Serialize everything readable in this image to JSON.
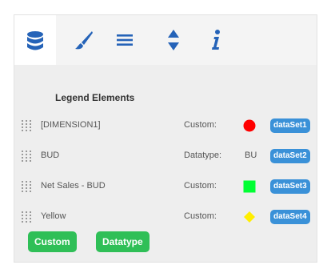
{
  "tabs": [
    {
      "icon": "database-icon",
      "active": true
    },
    {
      "icon": "brush-icon",
      "active": false
    },
    {
      "icon": "list-icon",
      "active": false
    },
    {
      "icon": "sort-icon",
      "active": false
    },
    {
      "icon": "info-icon",
      "active": false
    }
  ],
  "legend": {
    "title": "Legend Elements",
    "items": [
      {
        "label": "[DIMENSION1]",
        "type_label": "Custom:",
        "swatch": "circle",
        "color": "#ff0000",
        "dataset": "dataSet1"
      },
      {
        "label": "BUD",
        "type_label": "Datatype:",
        "swatch": "text",
        "swatch_text": "BU",
        "dataset": "dataSet2"
      },
      {
        "label": "Net Sales - BUD",
        "type_label": "Custom:",
        "swatch": "square",
        "color": "#00ff33",
        "dataset": "dataSet3"
      },
      {
        "label": "Yellow",
        "type_label": "Custom:",
        "swatch": "diamond",
        "color": "#ffee00",
        "dataset": "dataSet4"
      }
    ]
  },
  "buttons": {
    "custom_label": "Custom",
    "datatype_label": "Datatype"
  },
  "colors": {
    "accent_blue": "#2563b8",
    "pill_blue": "#3a91d8",
    "button_green": "#2fbf57"
  }
}
